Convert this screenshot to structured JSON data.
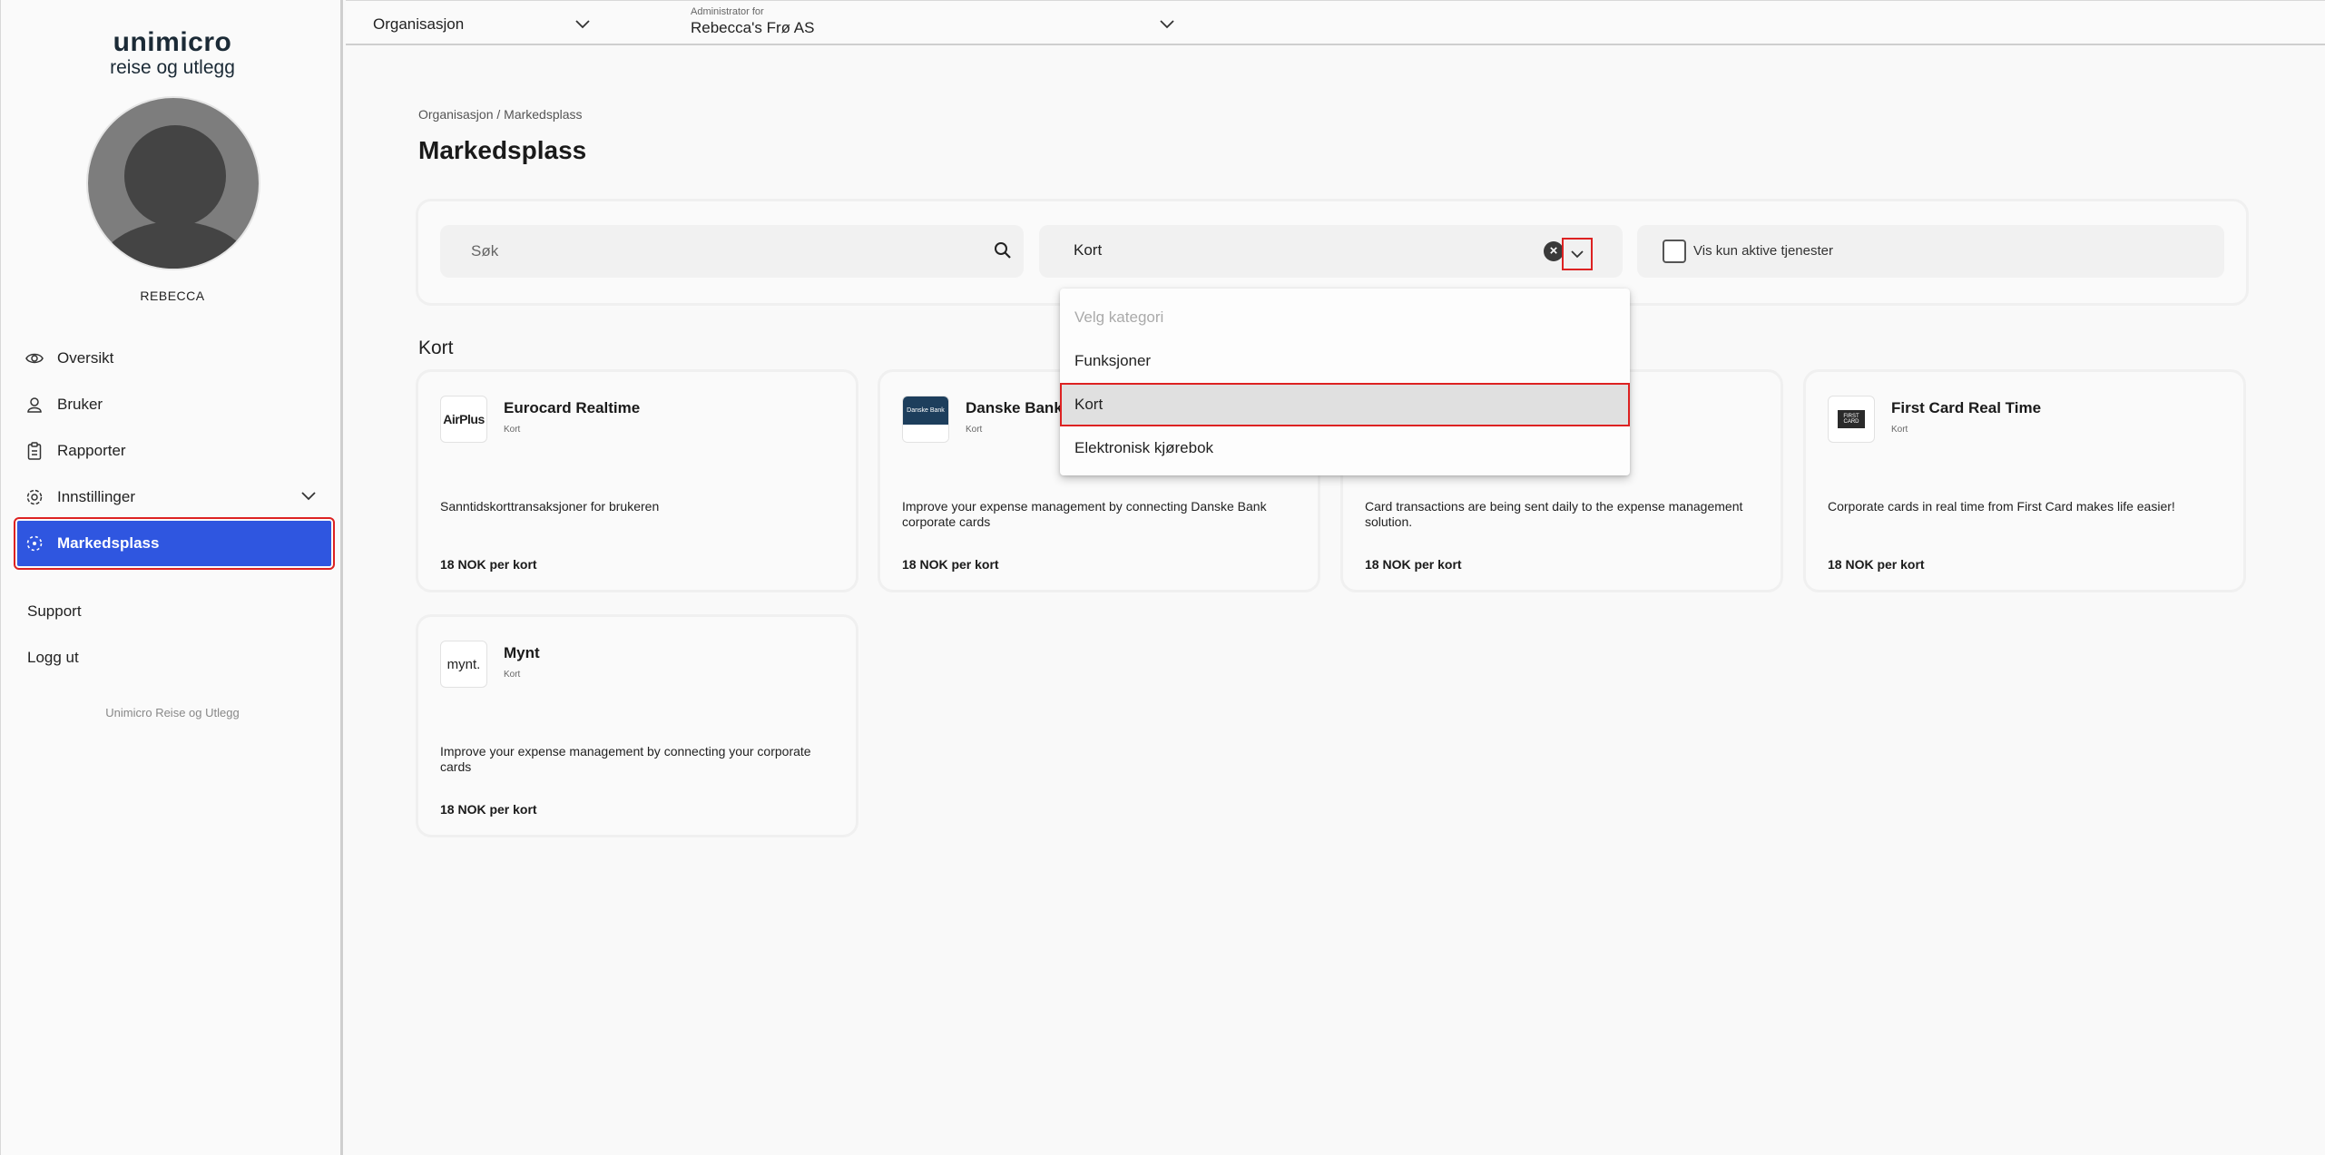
{
  "sidebar": {
    "logo_line1": "unimicro",
    "logo_line2": "reise og utlegg",
    "username": "REBECCA",
    "nav": [
      {
        "label": "Oversikt",
        "icon": "eye-icon"
      },
      {
        "label": "Bruker",
        "icon": "user-icon"
      },
      {
        "label": "Rapporter",
        "icon": "clipboard-icon"
      },
      {
        "label": "Innstillinger",
        "icon": "gear-icon"
      },
      {
        "label": "Markedsplass",
        "icon": "marketplace-icon",
        "active": true
      }
    ],
    "support": "Support",
    "logout": "Logg ut",
    "footer": "Unimicro Reise og Utlegg"
  },
  "topbar": {
    "org_label": "Organisasjon",
    "admin_small": "Administrator for",
    "admin_value": "Rebecca's Frø AS"
  },
  "main": {
    "breadcrumb": "Organisasjon / Markedsplass",
    "title": "Markedsplass",
    "search_placeholder": "Søk",
    "category_value": "Kort",
    "active_only_label": "Vis kun aktive tjenester",
    "section_title": "Kort",
    "cards": [
      {
        "name": "Eurocard Realtime",
        "category": "Kort",
        "logo_text": "AirPlus",
        "description": "Sanntidskorttransaksjoner for brukeren",
        "price": "18 NOK per kort"
      },
      {
        "name": "Danske Bank",
        "category": "Kort",
        "logo_text": "Danske Bank",
        "description": "Improve your expense management by connecting Danske Bank corporate cards",
        "price": "18 NOK per kort"
      },
      {
        "name": "",
        "category": "",
        "logo_text": "",
        "description": "Card transactions are being sent daily to the expense management solution.",
        "price": "18 NOK per kort"
      },
      {
        "name": "First Card Real Time",
        "category": "Kort",
        "logo_text": "FIRST CARD",
        "description": "Corporate cards in real time from First Card makes life easier!",
        "price": "18 NOK per kort"
      },
      {
        "name": "Mynt",
        "category": "Kort",
        "logo_text": "mynt.",
        "description": "Improve your expense management by connecting your corporate cards",
        "price": "18 NOK per kort"
      }
    ]
  },
  "dropdown": {
    "placeholder": "Velg kategori",
    "options": [
      "Funksjoner",
      "Kort",
      "Elektronisk kjørebok"
    ],
    "selected": "Kort"
  },
  "colors": {
    "accent": "#2f56e0",
    "highlight_border": "#dd2222"
  }
}
